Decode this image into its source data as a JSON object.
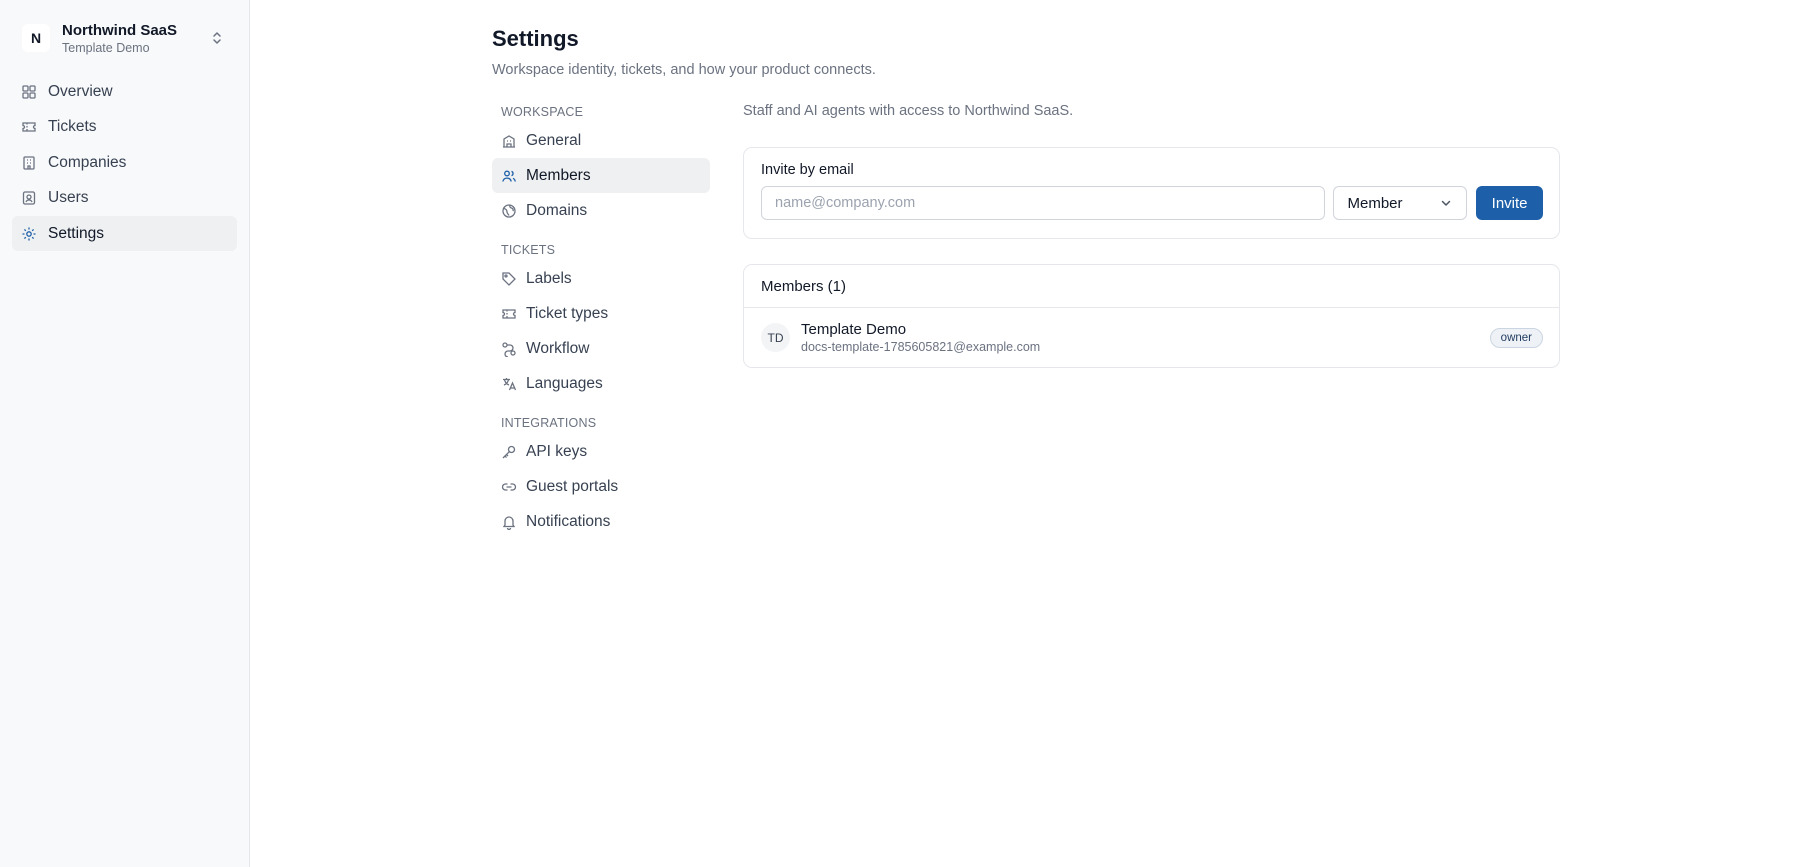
{
  "workspace": {
    "initial": "N",
    "name": "Northwind SaaS",
    "subtitle": "Template Demo"
  },
  "sidebar": {
    "items": [
      {
        "label": "Overview",
        "icon": "grid-icon",
        "active": false
      },
      {
        "label": "Tickets",
        "icon": "ticket-icon",
        "active": false
      },
      {
        "label": "Companies",
        "icon": "building-icon",
        "active": false
      },
      {
        "label": "Users",
        "icon": "user-badge-icon",
        "active": false
      },
      {
        "label": "Settings",
        "icon": "gear-icon",
        "active": true
      }
    ]
  },
  "page": {
    "title": "Settings",
    "subtitle": "Workspace identity, tickets, and how your product connects."
  },
  "subnav": {
    "sections": [
      {
        "title": "WORKSPACE",
        "items": [
          {
            "label": "General",
            "icon": "building-icon",
            "active": false
          },
          {
            "label": "Members",
            "icon": "users-icon",
            "active": true
          },
          {
            "label": "Domains",
            "icon": "globe-icon",
            "active": false
          }
        ]
      },
      {
        "title": "TICKETS",
        "items": [
          {
            "label": "Labels",
            "icon": "tag-icon",
            "active": false
          },
          {
            "label": "Ticket types",
            "icon": "ticket-icon",
            "active": false
          },
          {
            "label": "Workflow",
            "icon": "workflow-icon",
            "active": false
          },
          {
            "label": "Languages",
            "icon": "translate-icon",
            "active": false
          }
        ]
      },
      {
        "title": "INTEGRATIONS",
        "items": [
          {
            "label": "API keys",
            "icon": "key-icon",
            "active": false
          },
          {
            "label": "Guest portals",
            "icon": "link-icon",
            "active": false
          },
          {
            "label": "Notifications",
            "icon": "bell-icon",
            "active": false
          }
        ]
      }
    ]
  },
  "members_page": {
    "description": "Staff and AI agents with access to Northwind SaaS.",
    "invite": {
      "label": "Invite by email",
      "email_placeholder": "name@company.com",
      "email_value": "",
      "role_value": "Member",
      "button_label": "Invite"
    },
    "members_heading": "Members (1)",
    "members": [
      {
        "initials": "TD",
        "name": "Template Demo",
        "email": "docs-template-1785605821@example.com",
        "role": "owner"
      }
    ]
  },
  "colors": {
    "accent": "#1d5fa8",
    "sidebar_bg": "#f8f9fa",
    "active_bg": "#eef0f2"
  }
}
